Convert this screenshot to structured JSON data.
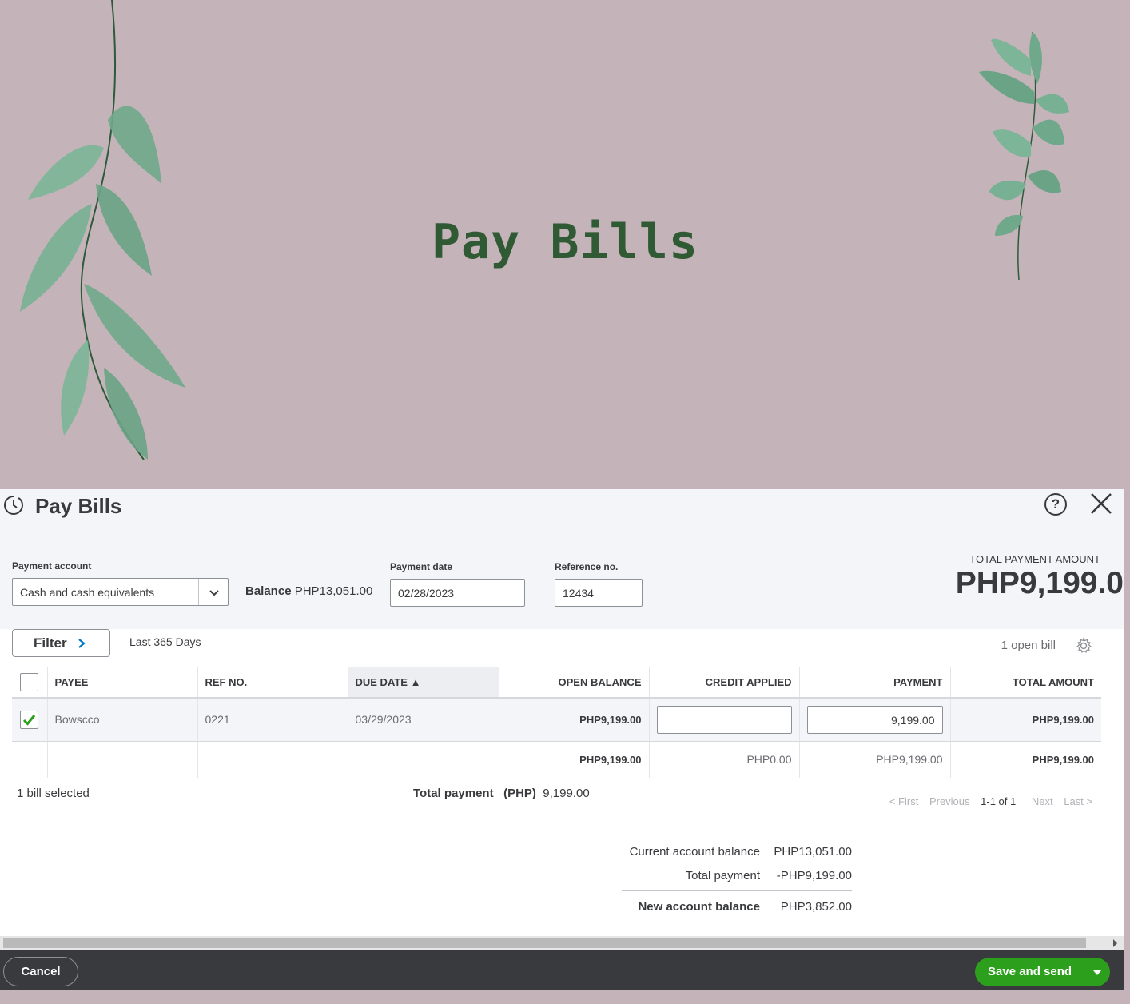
{
  "banner": {
    "title": "Pay Bills"
  },
  "dialog": {
    "title": "Pay Bills",
    "payment_account": {
      "label": "Payment account",
      "value": "Cash and cash equivalents"
    },
    "balance": {
      "label": "Balance",
      "value": "PHP13,051.00"
    },
    "payment_date": {
      "label": "Payment date",
      "value": "02/28/2023"
    },
    "reference_no": {
      "label": "Reference no.",
      "value": "12434"
    },
    "total_payment_amount": {
      "label": "TOTAL PAYMENT AMOUNT",
      "value": "PHP9,199.0"
    }
  },
  "filter": {
    "button_label": "Filter",
    "range": "Last 365 Days",
    "open_bill_count": "1 open bill"
  },
  "table": {
    "headers": {
      "payee": "PAYEE",
      "ref_no": "REF NO.",
      "due_date": "DUE DATE ▲",
      "open_balance": "OPEN BALANCE",
      "credit_applied": "CREDIT APPLIED",
      "payment": "PAYMENT",
      "total_amount": "TOTAL AMOUNT"
    },
    "rows": [
      {
        "checked": true,
        "payee": "Bowscco",
        "ref_no": "0221",
        "due_date": "03/29/2023",
        "open_balance": "PHP9,199.00",
        "credit_applied": "",
        "payment": "9,199.00",
        "total_amount": "PHP9,199.00"
      }
    ],
    "totals": {
      "open_balance": "PHP9,199.00",
      "credit_applied": "PHP0.00",
      "payment": "PHP9,199.00",
      "total_amount": "PHP9,199.00"
    }
  },
  "selection": {
    "bills_selected": "1 bill selected",
    "total_payment_label": "Total payment",
    "currency": "(PHP)",
    "total_payment_value": "9,199.00"
  },
  "pager": {
    "first": "< First",
    "previous": "Previous",
    "range": "1-1 of 1",
    "next": "Next",
    "last": "Last >"
  },
  "summary": {
    "current_label": "Current account balance",
    "current_value": "PHP13,051.00",
    "payment_label": "Total payment",
    "payment_value": "-PHP9,199.00",
    "new_label": "New account balance",
    "new_value": "PHP3,852.00"
  },
  "footer": {
    "cancel": "Cancel",
    "save": "Save and send"
  },
  "colors": {
    "banner_bg": "#c4b3b8",
    "title_green": "#2f5a34",
    "leaf_green": "#6fa88a",
    "primary_button": "#2ca01c",
    "footer_bg": "#393a3d"
  }
}
